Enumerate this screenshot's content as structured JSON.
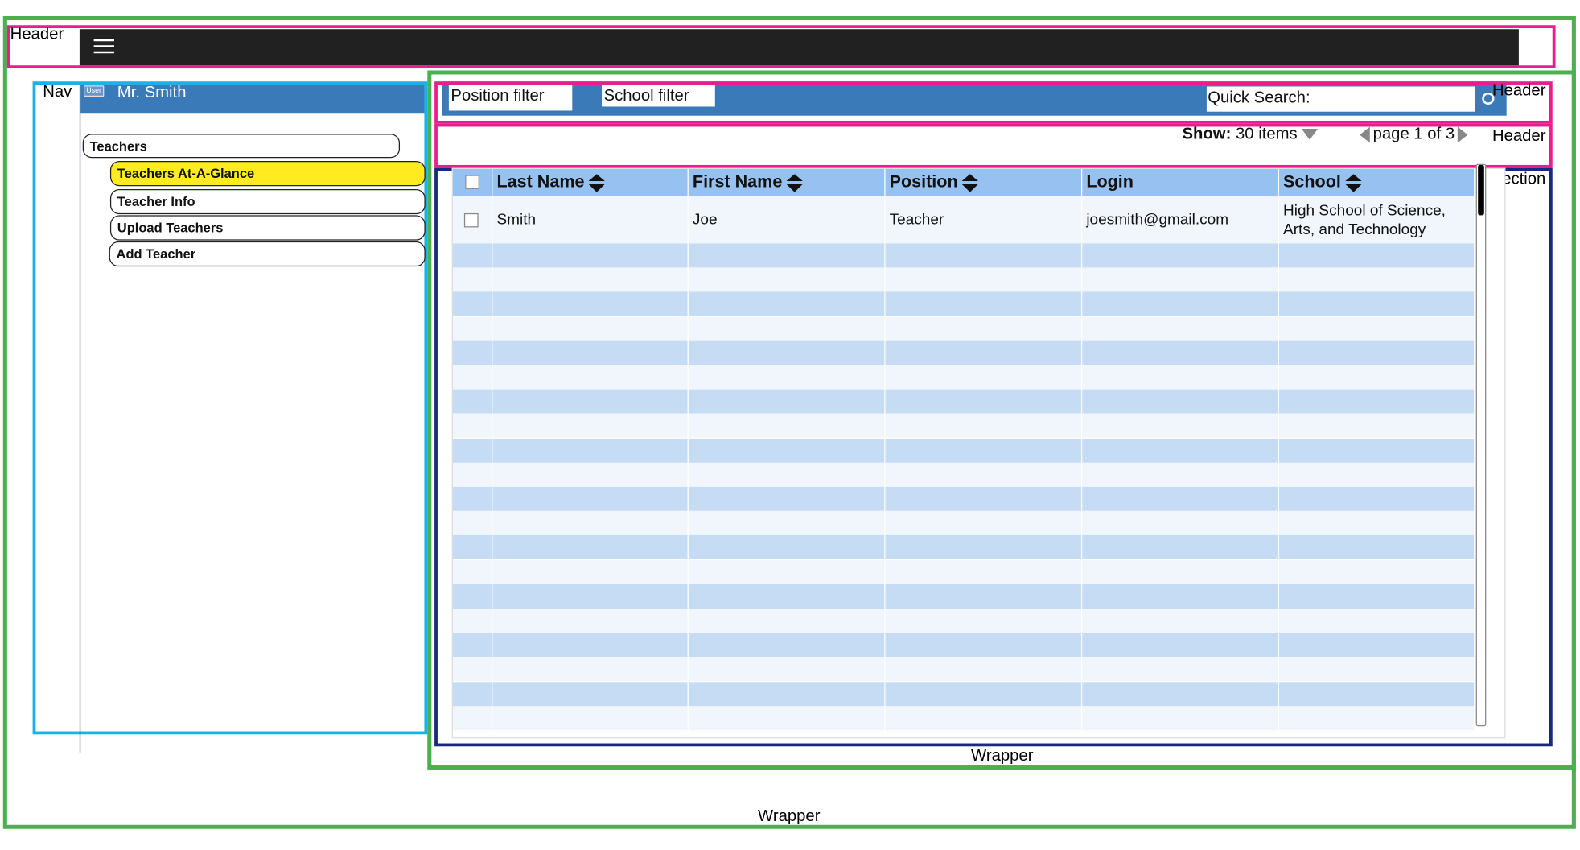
{
  "labels": {
    "header_outer": "Header",
    "nav": "Nav",
    "header_filter": "Header",
    "header_pager": "Header",
    "section": "Section",
    "wrapper_inner": "Wrapper",
    "wrapper_outer": "Wrapper"
  },
  "nav": {
    "user_badge": "User",
    "user_name": "Mr. Smith",
    "items": [
      {
        "label": "Teachers",
        "level": 0,
        "active": false
      },
      {
        "label": "Teachers At-A-Glance",
        "level": 1,
        "active": true
      },
      {
        "label": "Teacher Info",
        "level": 1,
        "active": false
      },
      {
        "label": "Upload Teachers",
        "level": 1,
        "active": false
      },
      {
        "label": "Add Teacher",
        "level": 1,
        "active": false
      }
    ]
  },
  "filters": {
    "position_placeholder": "Position filter",
    "school_placeholder": "School filter",
    "quick_search_label": "Quick Search:"
  },
  "pager": {
    "show_label": "Show:",
    "show_value": "30 items",
    "page_text": "page 1 of 3"
  },
  "table": {
    "columns": [
      "Last Name",
      "First Name",
      "Position",
      "Login",
      "School"
    ],
    "sortable": [
      true,
      true,
      true,
      false,
      true
    ],
    "rows": [
      {
        "last": "Smith",
        "first": "Joe",
        "position": "Teacher",
        "login": "joesmith@gmail.com",
        "school_line1": "High School of Science,",
        "school_line2": "Arts, and Technology"
      }
    ],
    "empty_rows": 20
  },
  "colors": {
    "top_bar": "#212121",
    "primary_blue": "#3a7ab8",
    "header_row": "#97c1f0",
    "row_alt": "#c5dcf4",
    "row_plain": "#f1f6fc",
    "active_nav": "#ffeb1f",
    "wire_green": "#4caf50",
    "wire_pink": "#e91e8c",
    "wire_cyan": "#1ab2e6",
    "wire_navy": "#1a2a7a"
  },
  "icons": [
    "hamburger-icon",
    "user-icon",
    "search-icon",
    "sort-icon",
    "dropdown-arrow-icon",
    "prev-page-icon",
    "next-page-icon"
  ]
}
